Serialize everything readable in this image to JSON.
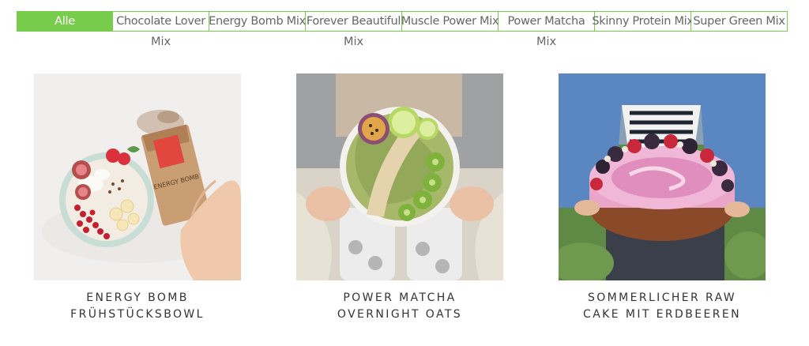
{
  "filters": [
    {
      "line1": "Alle",
      "line2": "",
      "active": true
    },
    {
      "line1": "Chocolate Lover",
      "line2": "Mix",
      "active": false
    },
    {
      "line1": "Energy Bomb Mix",
      "line2": "",
      "active": false
    },
    {
      "line1": "Forever Beautiful",
      "line2": "Mix",
      "active": false
    },
    {
      "line1": "Muscle Power Mix",
      "line2": "",
      "active": false
    },
    {
      "line1": "Power Matcha",
      "line2": "Mix",
      "active": false
    },
    {
      "line1": "Skinny Protein Mix",
      "line2": "",
      "active": false
    },
    {
      "line1": "Super Green Mix",
      "line2": "",
      "active": false
    }
  ],
  "recipes": [
    {
      "title_line1": "ENERGY BOMB",
      "title_line2": "FRÜHSTÜCKSBOWL",
      "pack_text": "ENERGY BOMB"
    },
    {
      "title_line1": "POWER MATCHA",
      "title_line2": "OVERNIGHT OATS"
    },
    {
      "title_line1": "SOMMERLICHER RAW",
      "title_line2": "CAKE MIT ERDBEEREN"
    }
  ],
  "colors": {
    "accent": "#78cc4c"
  }
}
